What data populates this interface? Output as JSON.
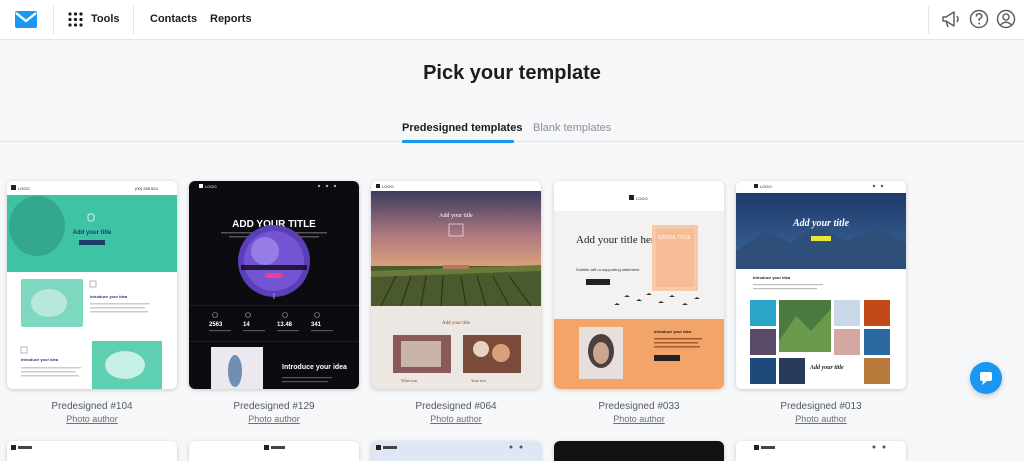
{
  "header": {
    "tools_label": "Tools",
    "nav": [
      "Contacts",
      "Reports"
    ],
    "icons": [
      "logo-icon",
      "apps-grid-icon",
      "megaphone-icon",
      "help-icon",
      "account-icon"
    ]
  },
  "page": {
    "title": "Pick your template"
  },
  "tabs": [
    {
      "label": "Predesigned templates",
      "active": true
    },
    {
      "label": "Blank templates",
      "active": false
    }
  ],
  "accent_color": "#1a97f5",
  "cards": [
    {
      "name": "Predesigned #104",
      "author": "Photo author",
      "thumb": {
        "logo": "LOGO",
        "phone": "(00) 255 624",
        "hero_title": "Add your title",
        "section": "Introduce your idea",
        "section2": "Introduce your idea"
      }
    },
    {
      "name": "Predesigned #129",
      "author": "Photo author",
      "thumb": {
        "logo": "LOGO",
        "hero_title": "ADD YOUR TITLE",
        "stats": [
          "2563",
          "14",
          "13.48",
          "341"
        ],
        "section": "Introduce your idea"
      }
    },
    {
      "name": "Predesigned #064",
      "author": "Photo author",
      "thumb": {
        "logo": "LOGO",
        "hero_title": "Add your title",
        "section": "Add your title",
        "caption1": "Wine tour",
        "caption2": "Your text"
      }
    },
    {
      "name": "Predesigned #033",
      "author": "Photo author",
      "thumb": {
        "logo": "LOGO",
        "hero_title": "Add your title here",
        "subtitle": "Subtitle with a supporting statement",
        "book": "EBOOK TITLE",
        "section": "Introduce your idea"
      }
    },
    {
      "name": "Predesigned #013",
      "author": "Photo author",
      "thumb": {
        "logo": "LOGO",
        "hero_title": "Add your title",
        "section": "Introduce your idea",
        "overlay": "Add your title"
      }
    }
  ],
  "chat_button": {
    "icon": "chat-icon"
  }
}
